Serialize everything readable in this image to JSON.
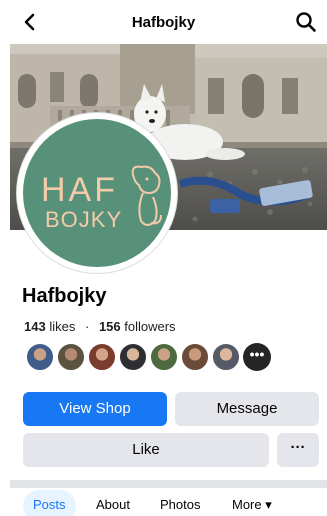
{
  "header": {
    "title": "Hafbojky",
    "back_icon": "chevron-left-icon",
    "search_icon": "search-icon"
  },
  "profile": {
    "logo_top": "HAF",
    "logo_bottom": "BOJKY",
    "name": "Hafbojky",
    "likes_count": "143",
    "likes_label": "likes",
    "separator": "·",
    "followers_count": "156",
    "followers_label": "followers",
    "friends_more": "•••"
  },
  "actions": {
    "shop_label": "View Shop",
    "message_label": "Message",
    "like_label": "Like",
    "more_label": "···"
  },
  "tabs": [
    {
      "label": "Posts",
      "active": true
    },
    {
      "label": "About",
      "active": false
    },
    {
      "label": "Photos",
      "active": false
    },
    {
      "label": "More ▾",
      "active": false
    }
  ],
  "colors": {
    "accent": "#1877f2",
    "logo_green": "#58917a",
    "logo_peach": "#f3cba9",
    "button_grey": "#e4e6eb"
  }
}
